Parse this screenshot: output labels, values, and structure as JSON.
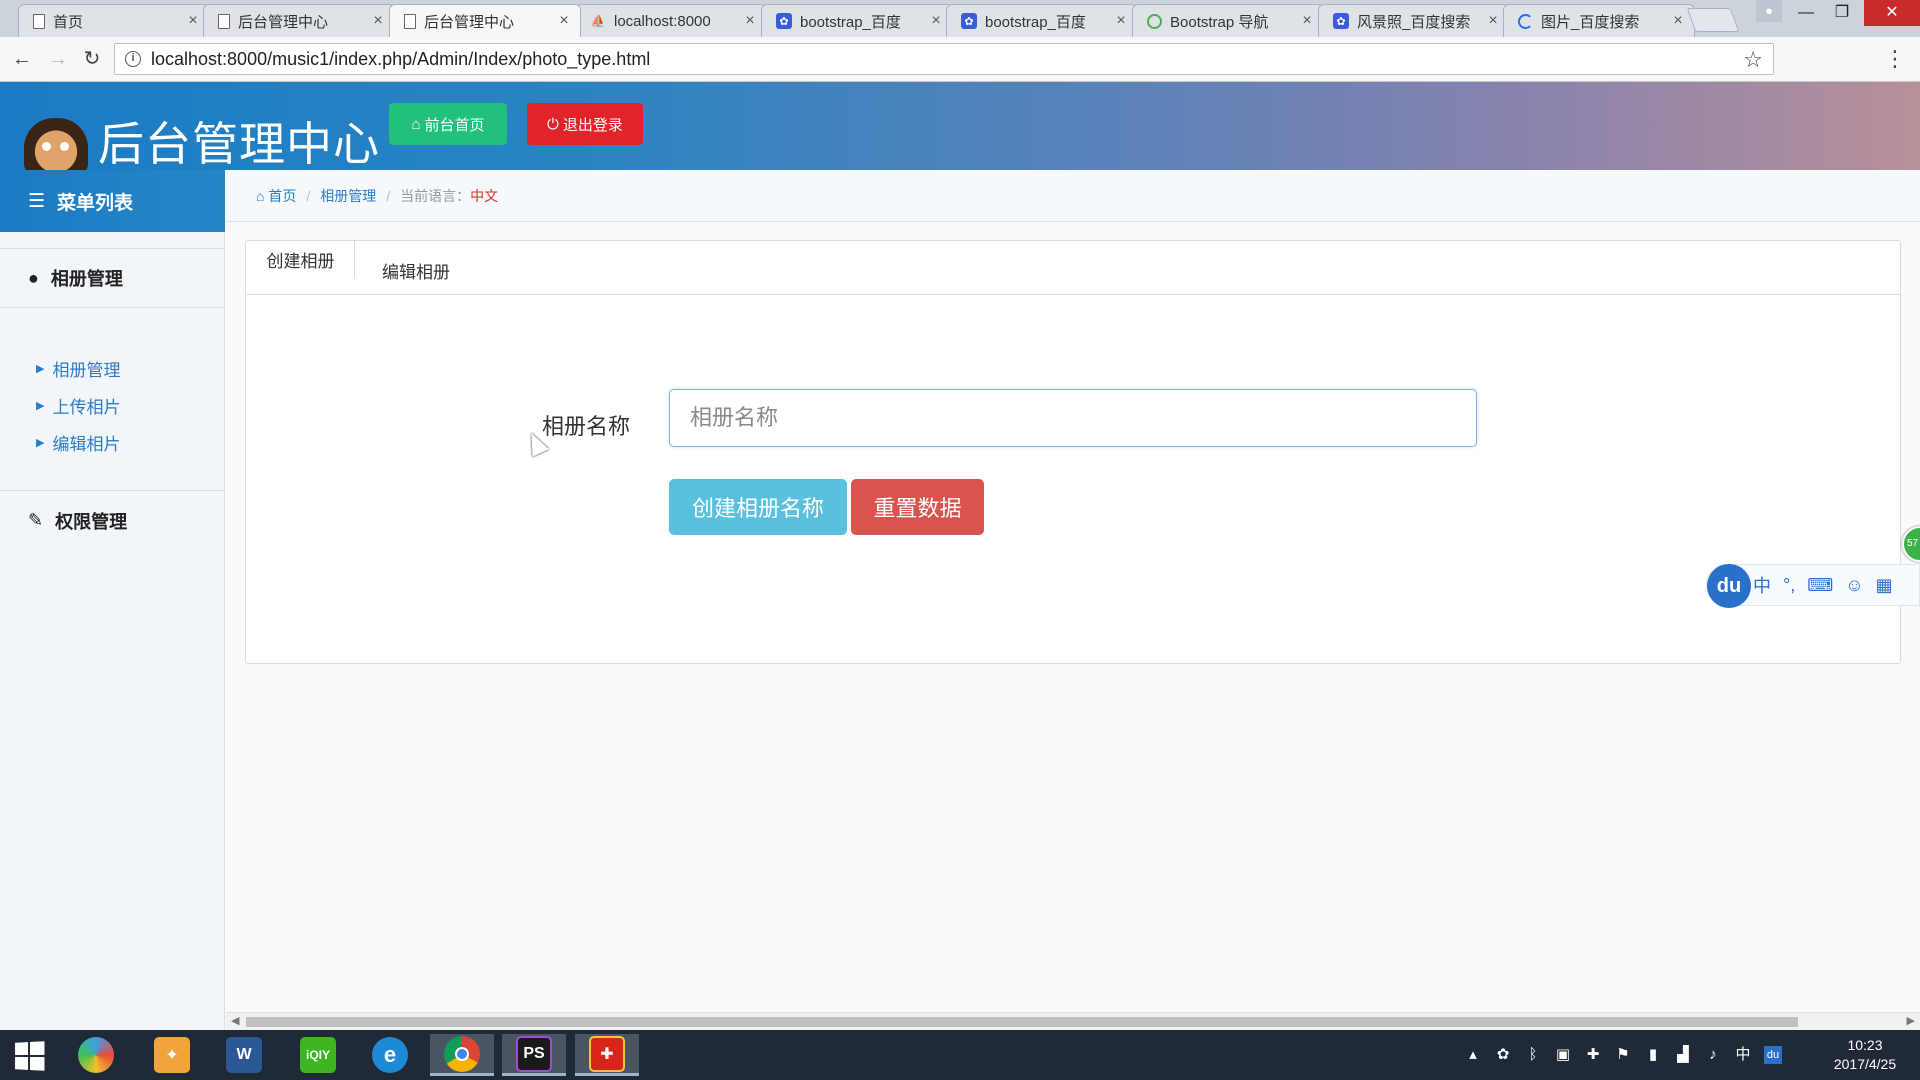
{
  "browser": {
    "tabs": [
      {
        "title": "首页",
        "icon": "doc-icon",
        "active": false
      },
      {
        "title": "后台管理中心",
        "icon": "doc-icon",
        "active": false
      },
      {
        "title": "后台管理中心",
        "icon": "doc-icon",
        "active": true
      },
      {
        "title": "localhost:8000",
        "icon": "pma-icon",
        "active": false
      },
      {
        "title": "bootstrap_百度",
        "icon": "baidu-paw-icon",
        "active": false
      },
      {
        "title": "bootstrap_百度",
        "icon": "baidu-paw-icon",
        "active": false
      },
      {
        "title": "Bootstrap 导航",
        "icon": "bootstrap-icon",
        "active": false
      },
      {
        "title": "风景照_百度搜索",
        "icon": "baidu-paw-icon",
        "active": false
      },
      {
        "title": "图片_百度搜索",
        "icon": "loading-icon",
        "active": false
      }
    ],
    "url": "localhost:8000/music1/index.php/Admin/Index/photo_type.html"
  },
  "header": {
    "title": "后台管理中心",
    "home_button": "前台首页",
    "logout_button": "退出登录"
  },
  "sidebar": {
    "menu_title": "菜单列表",
    "sections": [
      {
        "label": "相册管理",
        "items": [
          "相册管理",
          "上传相片",
          "编辑相片"
        ]
      },
      {
        "label": "权限管理",
        "items": []
      }
    ]
  },
  "breadcrumb": {
    "home": "首页",
    "current": "相册管理",
    "lang_label": "当前语言：",
    "lang_value": "中文"
  },
  "panel": {
    "tabs": [
      "创建相册",
      "编辑相册"
    ],
    "form": {
      "label": "相册名称",
      "placeholder": "相册名称",
      "value": "",
      "create_button": "创建相册名称",
      "reset_button": "重置数据"
    }
  },
  "ime": {
    "logo": "du",
    "mode": "中",
    "punct": "°,"
  },
  "float_ball_text": "57",
  "taskbar": {
    "apps": [
      "start-menu",
      "colorful-app",
      "sketch-app",
      "word",
      "iqiyi",
      "internet-explorer",
      "chrome",
      "phpstorm",
      "red-app"
    ],
    "tray_lang": "中",
    "clock_time": "10:23",
    "clock_date": "2017/4/25"
  },
  "colors": {
    "header_blue": "#1a7bc4",
    "home_green": "#21c07c",
    "logout_red": "#e1242a",
    "create_cyan": "#5bc0de",
    "reset_red": "#d9534f",
    "link_blue": "#2b7cc6"
  }
}
